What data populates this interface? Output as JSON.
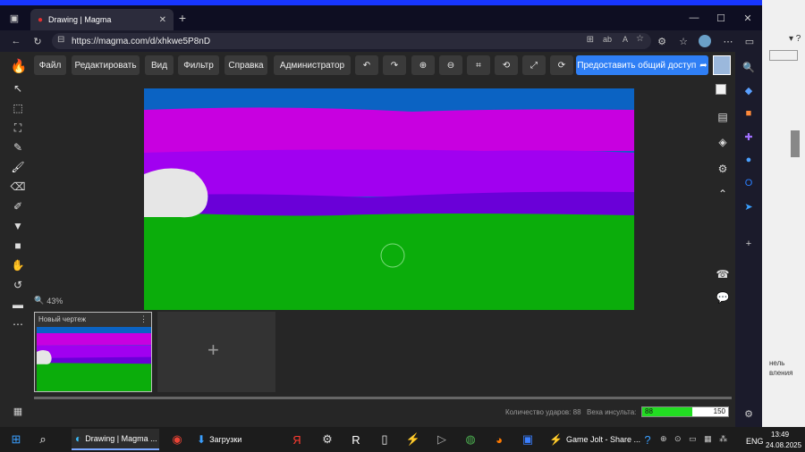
{
  "browser": {
    "tab_title": "Drawing | Magma",
    "url": "https://magma.com/d/xhkwe5P8nD",
    "new_tab": "+",
    "window_controls": [
      "—",
      "☐",
      "✕"
    ]
  },
  "menu": {
    "file": "Файл",
    "edit": "Редактировать",
    "view": "Вид",
    "filter": "Фильтр",
    "help": "Справка",
    "admin": "Администратор",
    "share": "Предоставить общий доступ"
  },
  "canvas": {
    "zoom": "43%",
    "colors": {
      "sky": "#0b63c3",
      "magenta": "#c800e0",
      "purple": "#a100f0",
      "violet": "#6a00d8",
      "grass": "#0bad0b",
      "cloud": "#e6e6e6"
    }
  },
  "drawings": {
    "title": "Новый чертеж",
    "add": "+"
  },
  "status": {
    "strokes_label": "Количество ударов: 88",
    "stroke_weight_label": "Веха инсульта:",
    "progress_value": "88",
    "progress_max": "150",
    "progress_fraction": 0.587
  },
  "taskbar": {
    "app1": "Drawing | Magma ...",
    "app2": "Загрузки",
    "app3": "Game Jolt - Share ...",
    "lang": "ENG",
    "time": "13:49",
    "date": "24.08.2025"
  },
  "right_strip": {
    "line1": "нель",
    "line2": "вления"
  }
}
